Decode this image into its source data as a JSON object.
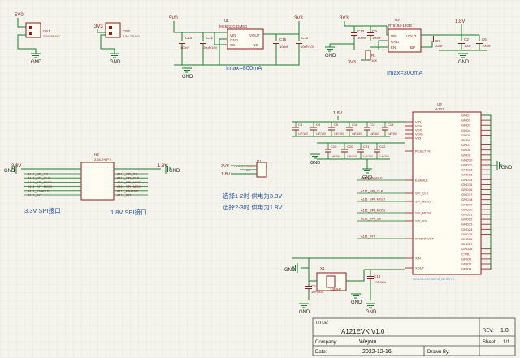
{
  "power": {
    "v5": "5V0",
    "v33": "3V3",
    "v18": "1.8V",
    "v33b": "3.3V",
    "v18b": "1.8V",
    "gnd": "GND"
  },
  "cn": {
    "cn1": {
      "ref": "CN1",
      "val": "2.54-2P W1"
    },
    "cn2": {
      "ref": "CN2",
      "val": "2.54-2P W1"
    }
  },
  "u1": {
    "ref": "U1",
    "part": "ME6211C33M5G",
    "pins": [
      "VIN",
      "VOUT",
      "GND",
      "CE",
      "NC"
    ],
    "c14": "C14",
    "c14v": "100nF",
    "c11": "C11",
    "c11v": "10uF/10V",
    "c15": "C15",
    "c15v": "100nF",
    "c12": "C12",
    "c12v": "10uF/10V",
    "imax": "Imax=800mA"
  },
  "u2": {
    "ref": "U2",
    "part": "RT9193-18GB",
    "pins": [
      "VIN",
      "VOUT",
      "GND",
      "EN",
      "BP"
    ],
    "c13": "C13",
    "c13v": "100nF",
    "c9": "C9",
    "c9v": "100nF",
    "c7": "C7",
    "c7v": "22nF",
    "c6": "C6",
    "c6v": "100nF",
    "c2": "C2",
    "c2v": "10uF",
    "r": "R1",
    "rv": "10K",
    "imax": "Imax=300mA"
  },
  "h2": {
    "ref": "H2",
    "val": "2.54-2*8P 2",
    "left": [
      "A111_SPI_SS",
      "A111_SPI_CLK",
      "A111_SPI_MISO",
      "A111_SPI_MOSI",
      "A111_ENABLE",
      "A111_INT"
    ],
    "right": [
      "A111_SPI_SS",
      "A111_SPI_CLK",
      "A111_SPI_MISO",
      "A111_SPI_MOSI",
      "A111_ENABLE",
      "A111_INT"
    ],
    "label_left": "3.3V SPI接口",
    "label_right": "1.8V SPI接口"
  },
  "p1": {
    "ref": "P1",
    "val": "Header-Male-2.54_1x3",
    "net": "VCC",
    "note1": "选择1-2时 供电为3.3V",
    "note2": "选择2-3时 供电为1.8V"
  },
  "decoup": [
    "C3",
    "C4",
    "C5",
    "C16",
    "C17",
    "C18",
    "C19",
    "C20",
    "C21",
    "C22"
  ],
  "decoup_v": "1uF/16V",
  "u3": {
    "ref": "U3",
    "part": "A121",
    "left_pins": [
      "VIO",
      "VDX",
      "VDX",
      "VDIG",
      "VIO",
      "RESET_N",
      "ENABLE",
      "SPI_CLK",
      "SPI_MISO",
      "SPI_MOSI",
      "SPI_SS",
      "INTERRUPT",
      "XIN",
      "XOUT"
    ],
    "left_nets": [
      "A111_ENABLE",
      "A111_SPI_CLK",
      "A111_SPI_MISO",
      "A111_SPI_MOSI",
      "A111_SPI_SS",
      "A111_INT"
    ],
    "right_pins": [
      "GND1",
      "GND2",
      "GND3",
      "GND4",
      "GND5",
      "GND6",
      "GND7",
      "GND8",
      "GND9",
      "GND10",
      "GND11",
      "GND12",
      "GND13",
      "GND14",
      "GND15",
      "GND16",
      "GND17",
      "GND18",
      "GND19",
      "GND20",
      "GND21",
      "GND22",
      "GND23",
      "GND24",
      "GND25",
      "GND26",
      "GND27",
      "GND28",
      "CTRL",
      "GPIO1",
      "GPIO2",
      "GPIO3"
    ],
    "footprint": "BGA38-2X2.4X0.8_NEXSYS"
  },
  "x1": {
    "ref": "X1",
    "val": "24MHz",
    "c5": "C5",
    "c5v": "10P/50V",
    "c10": "C10",
    "c10v": "10P/50V"
  },
  "titleblock": {
    "title_label": "TITLE:",
    "title": "A121EVK  V1.0",
    "rev_label": "REV:",
    "rev": "1.0",
    "company_label": "Company:",
    "company": "Wejoin",
    "sheet_label": "Sheet:",
    "sheet": "1/1",
    "date_label": "Date:",
    "date": "2022-12-16",
    "drawn_label": "Drawn By:"
  }
}
